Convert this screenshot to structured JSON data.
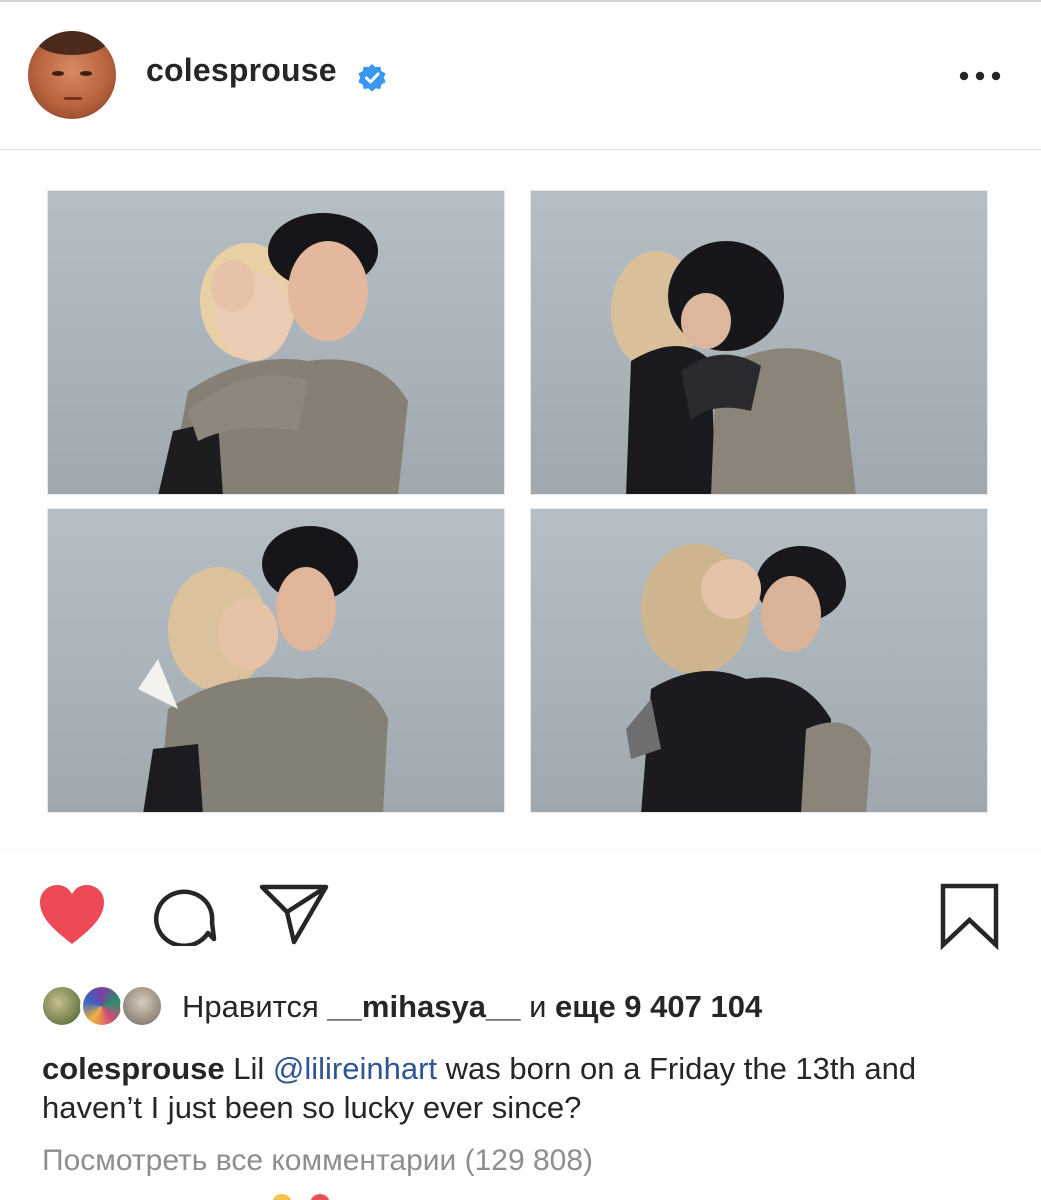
{
  "post": {
    "username": "colesprouse",
    "verified": true
  },
  "actions": {
    "liked": true,
    "like_color": "#ed4956"
  },
  "likes": {
    "prefix": "Нравится",
    "user": "__mihasya__",
    "conjunction": "и",
    "others": "еще 9 407 104"
  },
  "caption": {
    "username": "colesprouse",
    "text_before": " Lil ",
    "mention": "@lilireinhart",
    "text_after": " was born on a Friday the 13th and haven’t I just been so lucky ever since?"
  },
  "comments": {
    "view_all": "Посмотреть все комментарии (129 808)"
  },
  "colors": {
    "verified": "#3897f0",
    "mention": "#2f5594",
    "secondary_text": "#8e8e8e"
  }
}
